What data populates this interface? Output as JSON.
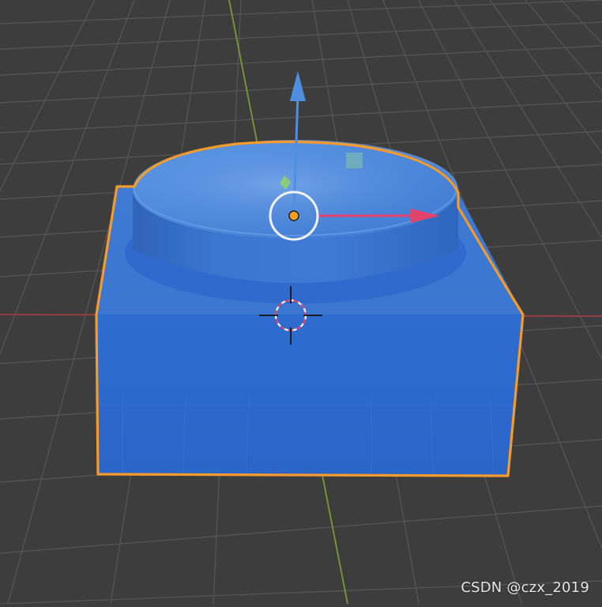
{
  "watermark": {
    "text": "CSDN @czx_2019"
  },
  "colors": {
    "background": "#3d3d3d",
    "grid_line": "#595959",
    "x_axis": "#9e3b45",
    "y_axis": "#7a9a34",
    "object_fill": "#2f6fd0",
    "object_top": "#4a86db",
    "selection_outline": "#f59a2c",
    "gizmo_x": "#e2436b",
    "gizmo_y": "#8fd36a",
    "gizmo_z": "#4e8fe0",
    "origin_point": "#f5a020"
  },
  "scene": {
    "selected_object": "object-selected",
    "tool": "move-gizmo",
    "icons": [
      "move-gizmo-icon",
      "3d-cursor-icon",
      "object-origin-icon"
    ]
  }
}
